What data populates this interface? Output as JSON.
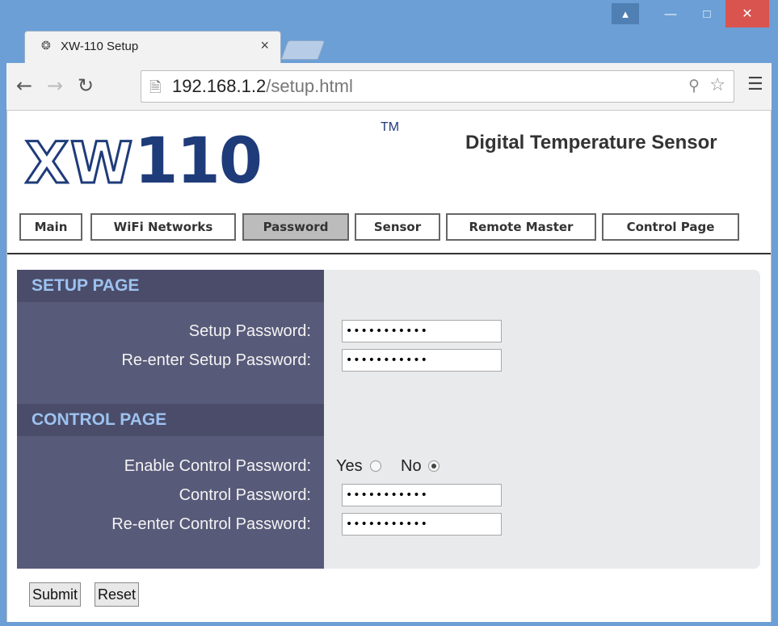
{
  "browser": {
    "tab_title": "XW-110 Setup",
    "tab_close": "×",
    "url_host": "192.168.1.2",
    "url_path": "/setup.html"
  },
  "header": {
    "logo_letters": "XW",
    "logo_number": "110",
    "logo_tm": "TM",
    "product_title": "Digital Temperature Sensor"
  },
  "nav": {
    "items": [
      {
        "label": "Main"
      },
      {
        "label": "WiFi Networks"
      },
      {
        "label": "Password",
        "active": true
      },
      {
        "label": "Sensor"
      },
      {
        "label": "Remote Master"
      },
      {
        "label": "Control Page"
      }
    ]
  },
  "setup_section": {
    "title": "SETUP PAGE",
    "password_label": "Setup Password:",
    "password_value": "•••••••••••",
    "reenter_label": "Re-enter Setup Password:",
    "reenter_value": "•••••••••••"
  },
  "control_section": {
    "title": "CONTROL PAGE",
    "enable_label": "Enable Control Password:",
    "option_yes": "Yes",
    "option_no": "No",
    "selected": "No",
    "password_label": "Control Password:",
    "password_value": "•••••••••••",
    "reenter_label": "Re-enter Control Password:",
    "reenter_value": "•••••••••••"
  },
  "buttons": {
    "submit": "Submit",
    "reset": "Reset"
  },
  "colors": {
    "titlebar": "#6b9fd6",
    "panel_dark": "#585a79",
    "section_header_text": "#9dc2f0",
    "logo_blue": "#1f3c7a"
  }
}
